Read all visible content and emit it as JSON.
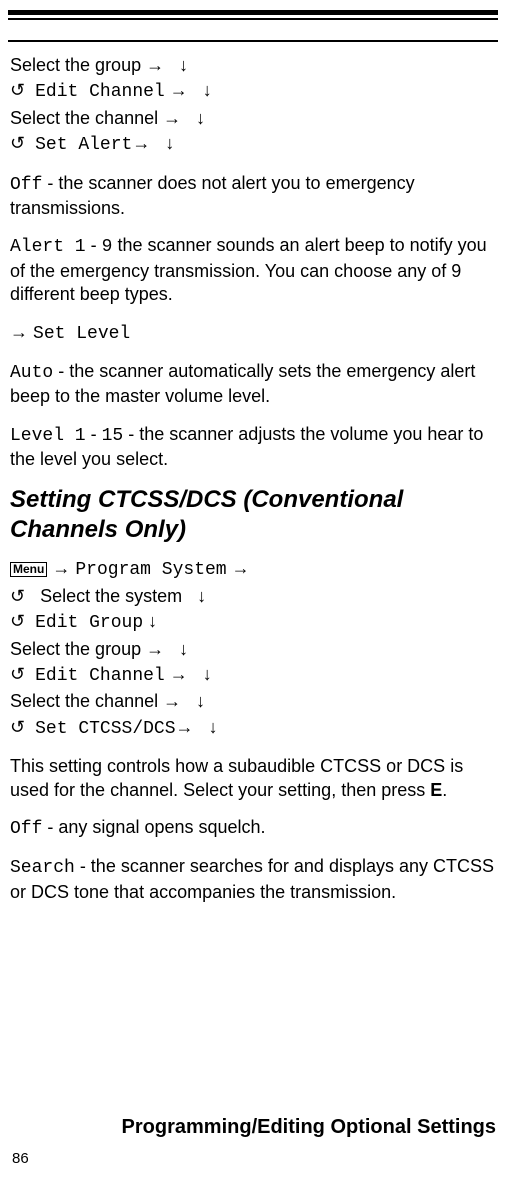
{
  "nav1": {
    "line1_a": "Select the group",
    "line2_b": "Edit Channel",
    "line3_a": "Select the channel",
    "line4_b": "Set Alert"
  },
  "off_para_a": "Off",
  "off_para_b": " - the scanner does not alert you to emergency transmissions.",
  "alert_a": "Alert 1",
  "alert_dash": " - ",
  "alert_b": "9",
  "alert_c": "  the scanner sounds an alert beep to notify you of the emergency transmission. You can choose any of 9 different beep types.",
  "set_level": "Set Level",
  "auto_a": "Auto",
  "auto_b": " - the scanner automatically sets the emergency alert beep to the master volume level.",
  "level_a": "Level 1",
  "level_dash": " - ",
  "level_b": "15",
  "level_c": " - the scanner adjusts the volume you hear to the level you select.",
  "heading": "Setting CTCSS/DCS (Conventional Channels Only)",
  "menu_label": "Menu",
  "nav2": {
    "prog_sys": "Program System",
    "select_system": "Select the system",
    "edit_group": "Edit Group",
    "select_group": "Select the group",
    "edit_channel": "Edit Channel",
    "select_channel": "Select the channel",
    "set_ctcss": "Set CTCSS/DCS"
  },
  "ctcss_para_a": "This setting controls how a subaudible CTCSS or DCS is used for the channel. Select your setting, then press ",
  "ctcss_para_b": "E",
  "ctcss_para_c": ".",
  "off2_a": "Off",
  "off2_b": " - any signal opens squelch.",
  "search_a": "Search",
  "search_b": " - the scanner searches for and displays any CTCSS or DCS tone that accompanies the transmission.",
  "footer": "Programming/Editing Optional Settings",
  "page": "86",
  "glyph": {
    "right": "→",
    "down": "↓",
    "refresh": "↻"
  }
}
